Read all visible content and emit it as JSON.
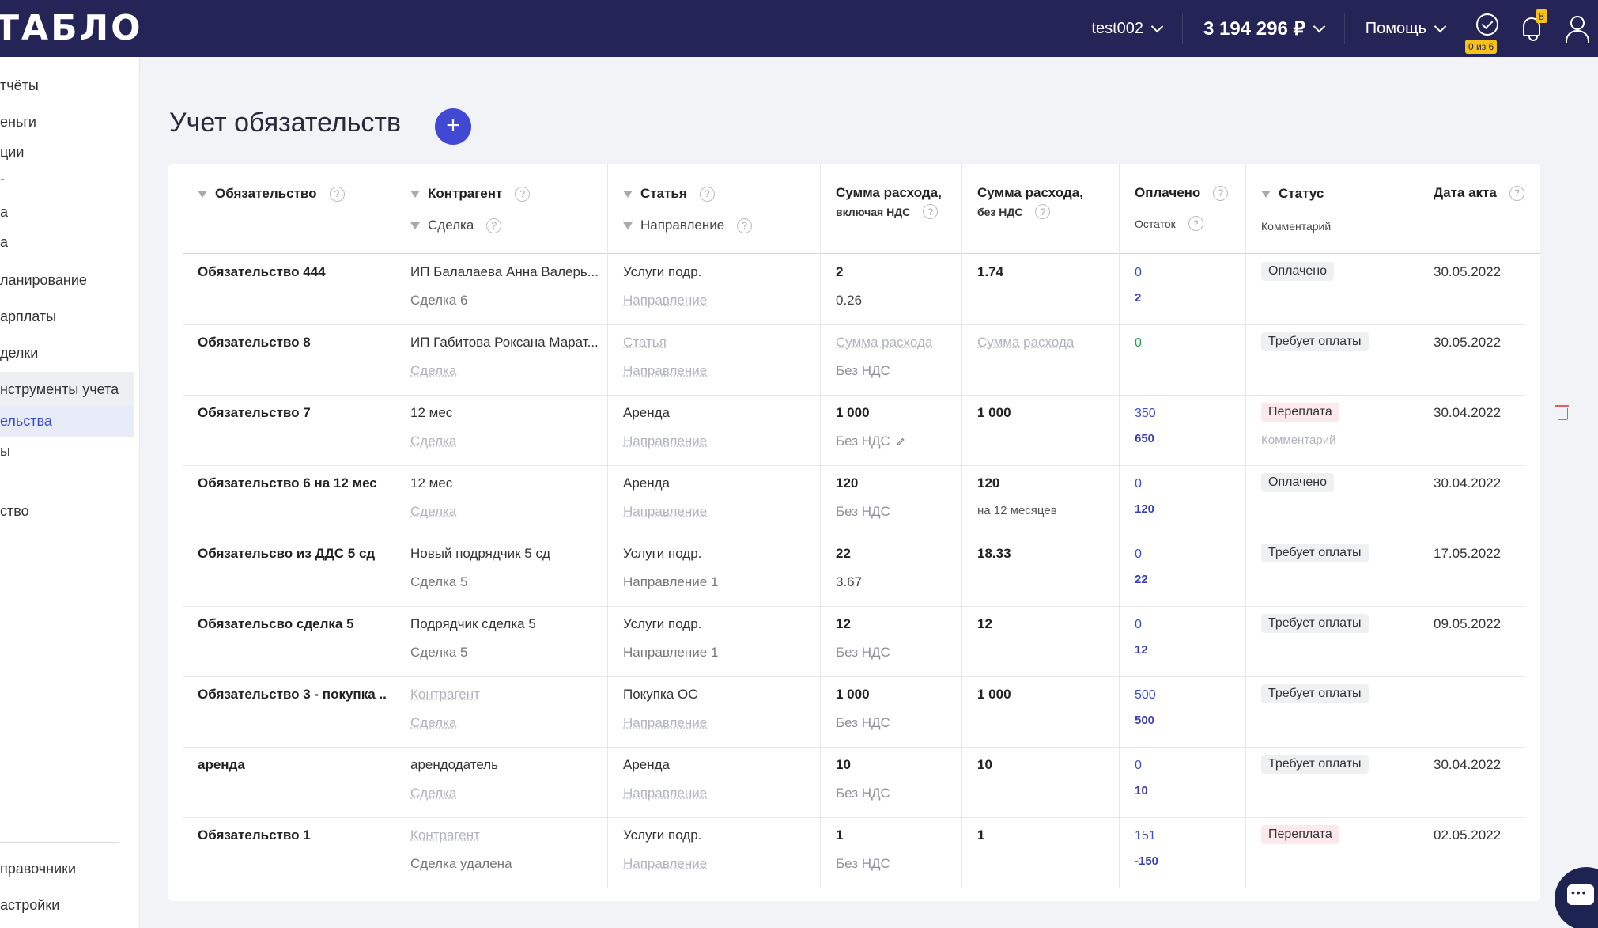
{
  "topbar": {
    "logo": "ТАБЛО",
    "account": "test002",
    "balance": "3 194 296 ₽",
    "help": "Помощь",
    "tasks_badge": "0 из 6",
    "notifications_count": "8"
  },
  "sidebar": {
    "items": [
      "тчёты",
      "еньги",
      "ции",
      "-",
      "а",
      "а",
      "ланирование",
      "арплаты",
      "делки",
      "нструменты учета",
      "ельства",
      "ы",
      "ство"
    ],
    "bottom": [
      "правочники",
      "астройки"
    ]
  },
  "page": {
    "title": "Учет обязательств",
    "add_button": "+"
  },
  "table": {
    "headers": {
      "obligation": "Обязательство",
      "counterparty": "Контрагент",
      "deal": "Сделка",
      "article": "Статья",
      "direction": "Направление",
      "sum_vat_1": "Сумма расхода,",
      "sum_vat_2": "включая НДС",
      "sum_novat_1": "Сумма расхода,",
      "sum_novat_2": "без НДС",
      "paid": "Оплачено",
      "remain": "Остаток",
      "status": "Статус",
      "comment": "Комментарий",
      "act_date": "Дата акта"
    },
    "rows": [
      {
        "name": "Обязательство 444",
        "counterparty": "ИП Балалаева Анна Валерь...",
        "deal": "Сделка 6",
        "article": "Услуги подр.",
        "direction": "Направление",
        "sum": "2",
        "vat": "0.26",
        "sum_novat": "1.74",
        "paid": "0",
        "remain": "2",
        "status": "Оплачено",
        "comment": "",
        "date": "30.05.2022"
      },
      {
        "name": "Обязательство 8",
        "counterparty": "ИП Габитова Роксана Марат...",
        "deal": "Сделка",
        "article": "Статья",
        "direction": "Направление",
        "sum": "Сумма расхода",
        "vat": "Без НДС",
        "sum_novat": "Сумма расхода",
        "paid": "0",
        "remain": "",
        "status": "Требует оплаты",
        "comment": "",
        "date": "30.05.2022"
      },
      {
        "name": "Обязательство 7",
        "counterparty": "12 мес",
        "deal": "Сделка",
        "article": "Аренда",
        "direction": "Направление",
        "sum": "1 000",
        "vat": "Без НДС",
        "sum_novat": "1 000",
        "paid": "350",
        "remain": "650",
        "status": "Переплата",
        "comment": "Комментарий",
        "date": "30.04.2022"
      },
      {
        "name": "Обязательство 6 на 12 мес",
        "counterparty": "12 мес",
        "deal": "Сделка",
        "article": "Аренда",
        "direction": "Направление",
        "sum": "120",
        "vat": "Без НДС",
        "sum_novat": "120",
        "sum_novat_note": "на 12 месяцев",
        "paid": "0",
        "remain": "120",
        "status": "Оплачено",
        "comment": "",
        "date": "30.04.2022"
      },
      {
        "name": "Обязательсво из ДДС 5 сд",
        "counterparty": "Новый подрядчик 5 сд",
        "deal": "Сделка 5",
        "article": "Услуги подр.",
        "direction": "Направление 1",
        "sum": "22",
        "vat": "3.67",
        "sum_novat": "18.33",
        "paid": "0",
        "remain": "22",
        "status": "Требует оплаты",
        "comment": "",
        "date": "17.05.2022"
      },
      {
        "name": "Обязательсво сделка 5",
        "counterparty": "Подрядчик сделка 5",
        "deal": "Сделка 5",
        "article": "Услуги подр.",
        "direction": "Направление 1",
        "sum": "12",
        "vat": "Без НДС",
        "sum_novat": "12",
        "paid": "0",
        "remain": "12",
        "status": "Требует оплаты",
        "comment": "",
        "date": "09.05.2022"
      },
      {
        "name": "Обязательство 3 - покупка ...",
        "counterparty": "Контрагент",
        "deal": "Сделка",
        "article": "Покупка ОС",
        "direction": "Направление",
        "sum": "1 000",
        "vat": "Без НДС",
        "sum_novat": "1 000",
        "paid": "500",
        "remain": "500",
        "status": "Требует оплаты",
        "comment": "",
        "date": ""
      },
      {
        "name": "аренда",
        "counterparty": "арендодатель",
        "deal": "Сделка",
        "article": "Аренда",
        "direction": "Направление",
        "sum": "10",
        "vat": "Без НДС",
        "sum_novat": "10",
        "paid": "0",
        "remain": "10",
        "status": "Требует оплаты",
        "comment": "",
        "date": "30.04.2022"
      },
      {
        "name": "Обязательство 1",
        "counterparty": "Контрагент",
        "deal": "Сделка удалена",
        "article": "Услуги подр.",
        "direction": "Направление",
        "sum": "1",
        "vat": "Без НДС",
        "sum_novat": "1",
        "paid": "151",
        "remain": "-150",
        "status": "Переплата",
        "comment": "",
        "date": "02.05.2022"
      }
    ]
  },
  "colors": {
    "topbar": "#242456",
    "accent": "#4048d4",
    "badge_yellow": "#f7c21a",
    "link_blue": "#3a4bd3"
  }
}
